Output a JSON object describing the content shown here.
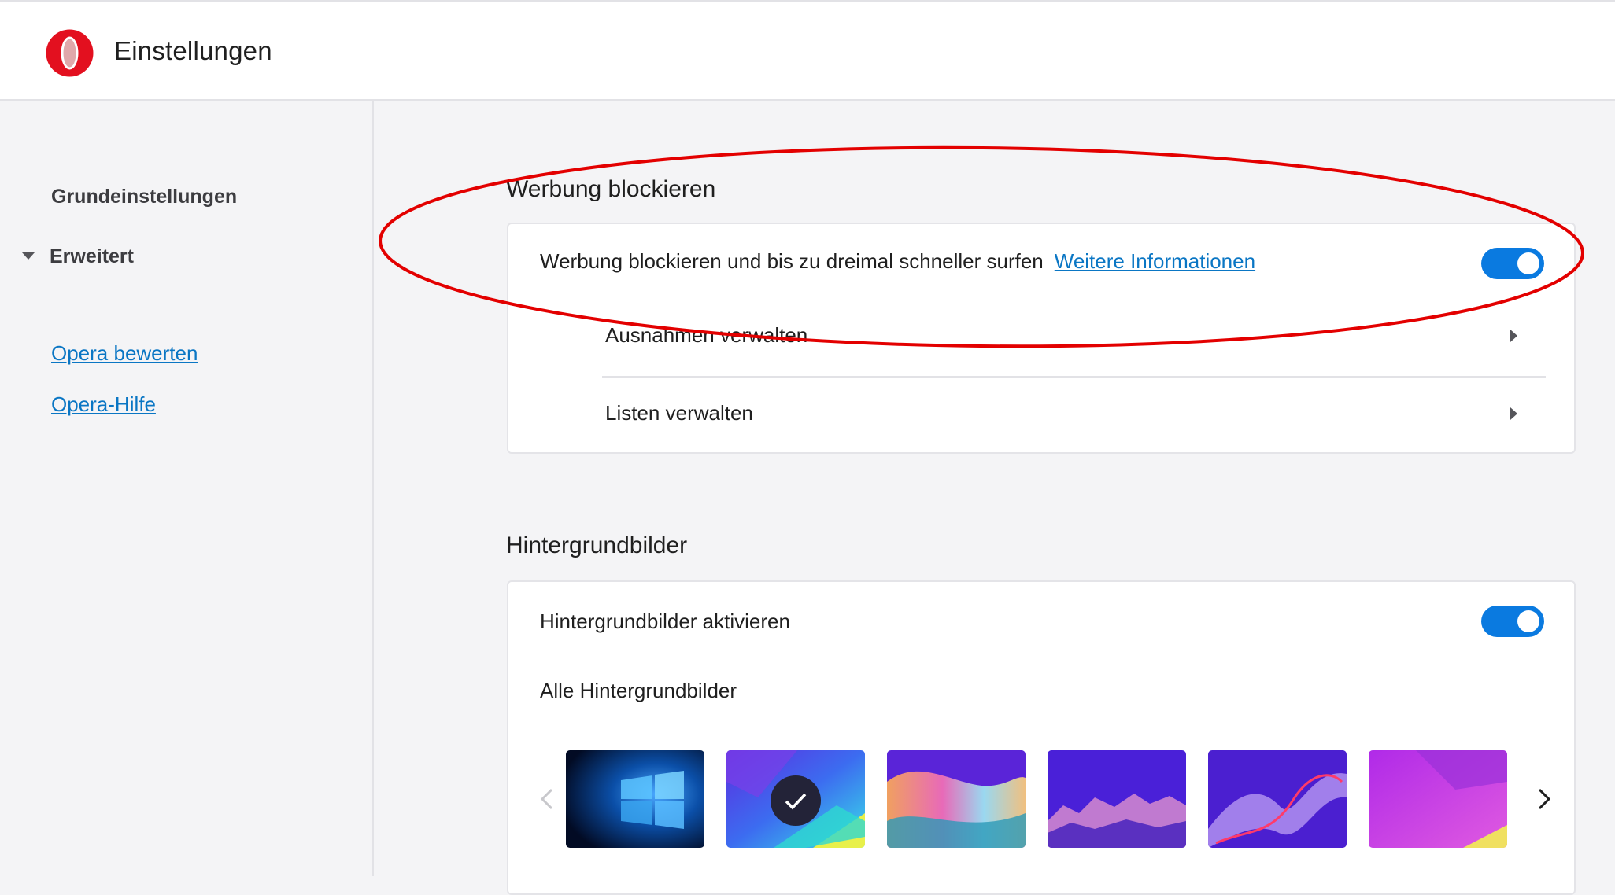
{
  "header": {
    "title": "Einstellungen",
    "logo_icon": "opera-logo-icon",
    "brand_color": "#e3101f"
  },
  "sidebar": {
    "items": [
      {
        "label": "Grundeinstellungen"
      },
      {
        "label": "Erweitert",
        "icon": "caret-down-icon"
      }
    ],
    "links": [
      {
        "label": "Opera bewerten"
      },
      {
        "label": "Opera-Hilfe"
      }
    ]
  },
  "ad_block": {
    "title": "Werbung blockieren",
    "toggle_label": "Werbung blockieren und bis zu dreimal schneller surfen",
    "more_info": "Weitere Informationen",
    "enabled": true,
    "rows": [
      {
        "label": "Ausnahmen verwalten",
        "icon": "chevron-right-icon"
      },
      {
        "label": "Listen verwalten",
        "icon": "chevron-right-icon"
      }
    ]
  },
  "wallpapers": {
    "title": "Hintergrundbilder",
    "toggle_label": "Hintergrundbilder aktivieren",
    "enabled": true,
    "all_label": "Alle Hintergrundbilder",
    "selected_index": 1,
    "thumbnails": [
      {
        "name": "windows-wallpaper"
      },
      {
        "name": "purple-cyan-wallpaper"
      },
      {
        "name": "wave-wallpaper"
      },
      {
        "name": "landscape-wallpaper"
      },
      {
        "name": "ribbon-wallpaper"
      },
      {
        "name": "magenta-wallpaper"
      }
    ]
  },
  "colors": {
    "accent": "#0a7ae0",
    "link": "#0a76c4",
    "annotation": "#e30000"
  }
}
